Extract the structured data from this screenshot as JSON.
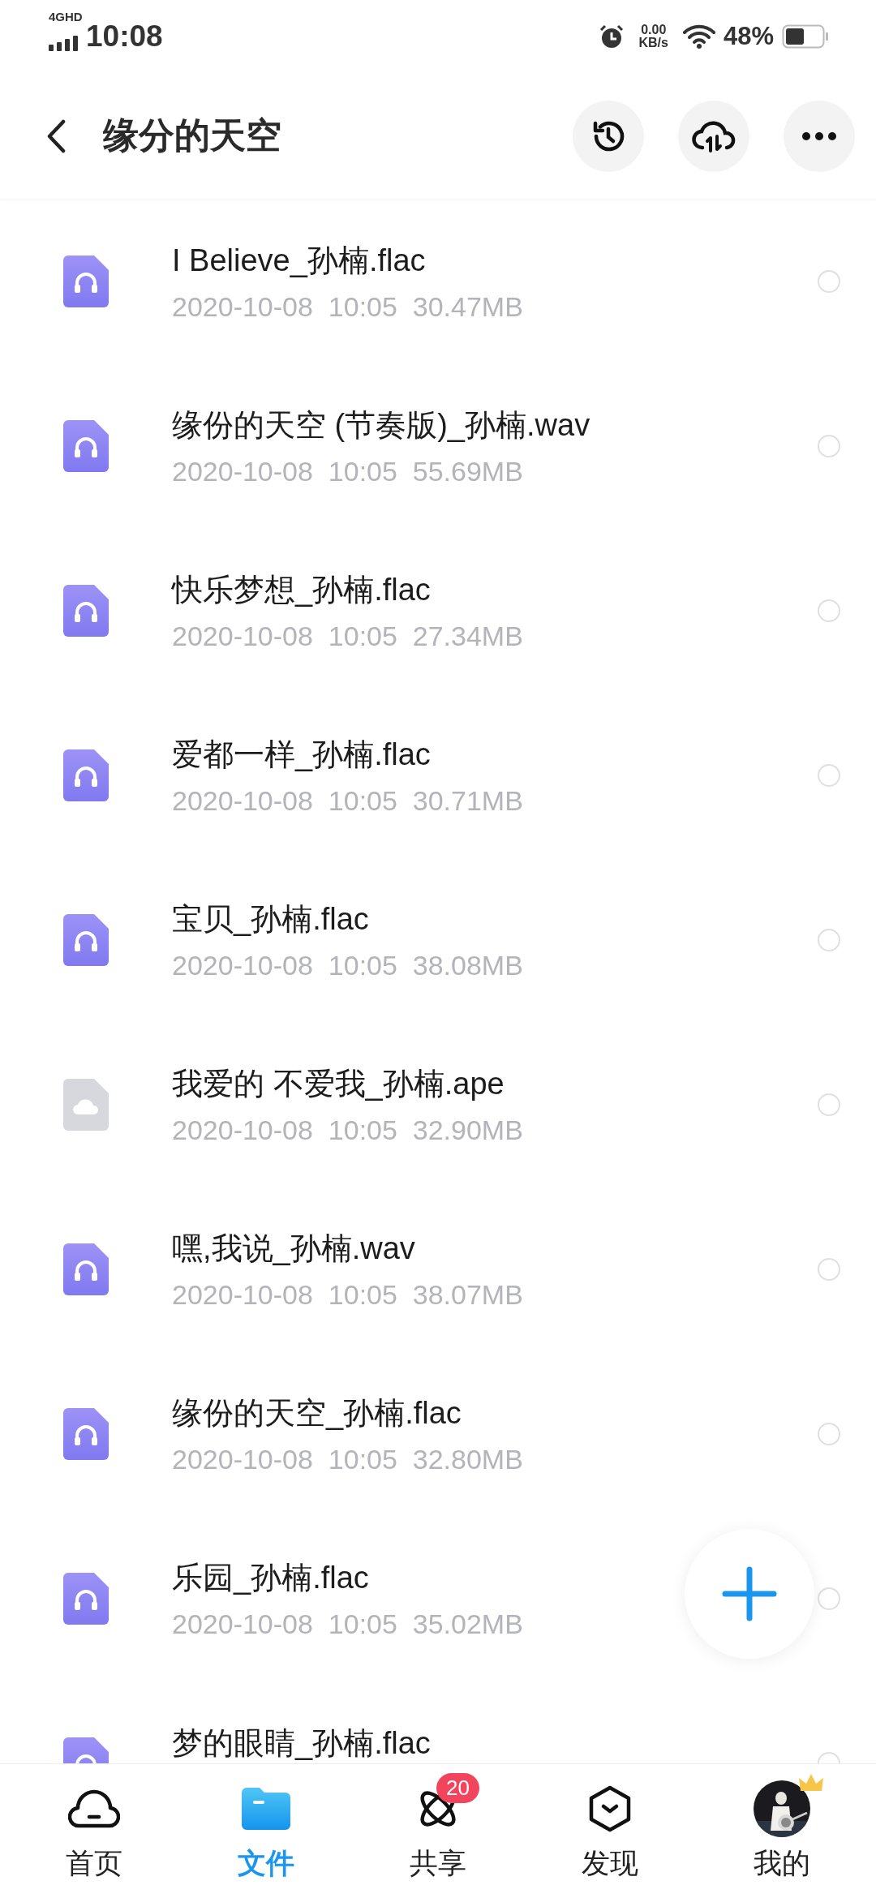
{
  "status_bar": {
    "network": "4GHD",
    "time": "10:08",
    "speed": "0.00",
    "speed_unit": "KB/s",
    "battery": "48%"
  },
  "header": {
    "title": "缘分的天空"
  },
  "files": [
    {
      "name": "I Believe_孙楠.flac",
      "meta": "2020-10-08  10:05  30.47MB",
      "kind": "audio",
      "selected": false
    },
    {
      "name": "缘份的天空 (节奏版)_孙楠.wav",
      "meta": "2020-10-08  10:05  55.69MB",
      "kind": "audio",
      "selected": false
    },
    {
      "name": "快乐梦想_孙楠.flac",
      "meta": "2020-10-08  10:05  27.34MB",
      "kind": "audio",
      "selected": false
    },
    {
      "name": "爱都一样_孙楠.flac",
      "meta": "2020-10-08  10:05  30.71MB",
      "kind": "audio",
      "selected": false
    },
    {
      "name": "宝贝_孙楠.flac",
      "meta": "2020-10-08  10:05  38.08MB",
      "kind": "audio",
      "selected": false
    },
    {
      "name": "我爱的 不爱我_孙楠.ape",
      "meta": "2020-10-08  10:05  32.90MB",
      "kind": "cloud",
      "selected": false
    },
    {
      "name": "嘿,我说_孙楠.wav",
      "meta": "2020-10-08  10:05  38.07MB",
      "kind": "audio",
      "selected": false
    },
    {
      "name": "缘份的天空_孙楠.flac",
      "meta": "2020-10-08  10:05  32.80MB",
      "kind": "audio",
      "selected": false
    },
    {
      "name": "乐园_孙楠.flac",
      "meta": "2020-10-08  10:05  35.02MB",
      "kind": "audio",
      "selected": false
    },
    {
      "name": "梦的眼睛_孙楠.flac",
      "kind": "audio",
      "selected": false
    }
  ],
  "nav": [
    {
      "label": "首页",
      "kind": "home",
      "selected": false
    },
    {
      "label": "文件",
      "kind": "files",
      "selected": true
    },
    {
      "label": "共享",
      "kind": "share",
      "selected": false,
      "badge": "20"
    },
    {
      "label": "发现",
      "kind": "discover",
      "selected": false
    },
    {
      "label": "我的",
      "kind": "me",
      "selected": false
    }
  ]
}
